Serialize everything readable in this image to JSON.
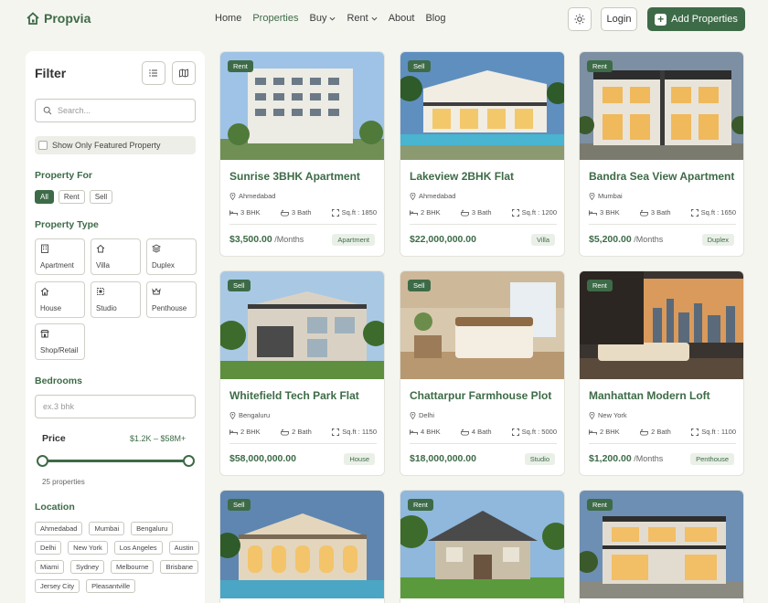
{
  "brand": {
    "name": "Propvia"
  },
  "nav": {
    "home": "Home",
    "properties": "Properties",
    "buy": "Buy",
    "rent": "Rent",
    "about": "About",
    "blog": "Blog"
  },
  "header": {
    "login": "Login",
    "add": "Add Properties"
  },
  "filter": {
    "title": "Filter",
    "search_placeholder": "Search...",
    "featured_label": "Show Only Featured Property",
    "property_for_title": "Property For",
    "property_for": [
      "All",
      "Rent",
      "Sell"
    ],
    "property_type_title": "Property Type",
    "property_types": [
      "Apartment",
      "Villa",
      "Duplex",
      "House",
      "Studio",
      "Penthouse",
      "Shop/Retail"
    ],
    "bedrooms_title": "Bedrooms",
    "bedrooms_placeholder": "ex.3 bhk",
    "price_title": "Price",
    "price_range": "$1.2K – $58M+",
    "property_count": "25 properties",
    "location_title": "Location",
    "locations": [
      "Ahmedabad",
      "Mumbai",
      "Bengaluru",
      "Delhi",
      "New York",
      "Los Angeles",
      "Austin",
      "Miami",
      "Sydney",
      "Melbourne",
      "Brisbane",
      "Jersey City",
      "Pleasantville"
    ]
  },
  "listings": [
    {
      "badge": "Rent",
      "title": "Sunrise 3BHK Apartment",
      "location": "Ahmedabad",
      "bhk": "3 BHK",
      "bath": "3 Bath",
      "sqft": "Sq.ft : 1850",
      "price": "$3,500.00",
      "unit": " /Months",
      "type": "Apartment"
    },
    {
      "badge": "Sell",
      "title": "Lakeview 2BHK Flat",
      "location": "Ahmedabad",
      "bhk": "2 BHK",
      "bath": "3 Bath",
      "sqft": "Sq.ft : 1200",
      "price": "$22,000,000.00",
      "unit": "",
      "type": "Villa"
    },
    {
      "badge": "Rent",
      "title": "Bandra Sea View Apartment",
      "location": "Mumbai",
      "bhk": "3 BHK",
      "bath": "3 Bath",
      "sqft": "Sq.ft : 1650",
      "price": "$5,200.00",
      "unit": " /Months",
      "type": "Duplex"
    },
    {
      "badge": "Sell",
      "title": "Whitefield Tech Park Flat",
      "location": "Bengaluru",
      "bhk": "2 BHK",
      "bath": "2 Bath",
      "sqft": "Sq.ft : 1150",
      "price": "$58,000,000.00",
      "unit": "",
      "type": "House"
    },
    {
      "badge": "Sell",
      "title": "Chattarpur Farmhouse Plot",
      "location": "Delhi",
      "bhk": "4 BHK",
      "bath": "4 Bath",
      "sqft": "Sq.ft : 5000",
      "price": "$18,000,000.00",
      "unit": "",
      "type": "Studio"
    },
    {
      "badge": "Rent",
      "title": "Manhattan Modern Loft",
      "location": "New York",
      "bhk": "2 BHK",
      "bath": "2 Bath",
      "sqft": "Sq.ft : 1100",
      "price": "$1,200.00",
      "unit": " /Months",
      "type": "Penthouse"
    },
    {
      "badge": "Sell"
    },
    {
      "badge": "Rent"
    },
    {
      "badge": "Rent"
    }
  ],
  "colors": {
    "accent": "#3d6b47",
    "background": "#f5f5f0"
  }
}
